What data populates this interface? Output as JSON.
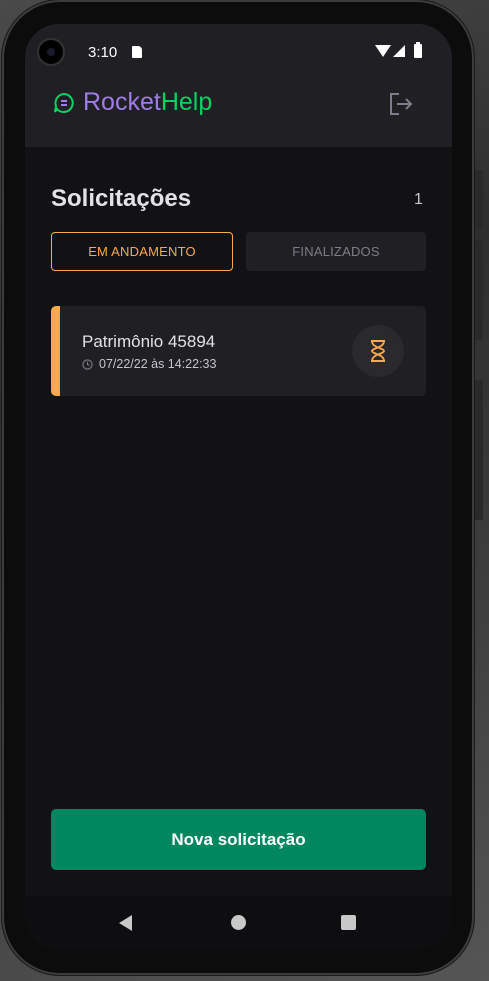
{
  "statusbar": {
    "time": "3:10"
  },
  "header": {
    "logo_part1": "Rocket",
    "logo_part2": "Help",
    "colors": {
      "rocket": "#9f7ce8",
      "help": "#04d361"
    }
  },
  "main": {
    "title": "Solicitações",
    "count": "1",
    "filters": [
      {
        "label": "EM ANDAMENTO",
        "active": true
      },
      {
        "label": "FINALIZADOS",
        "active": false
      }
    ],
    "orders": [
      {
        "title": "Patrimônio 45894",
        "datetime": "07/22/22 às 14:22:33",
        "status": "open",
        "status_icon": "hourglass-icon",
        "status_color": "#fba94c"
      }
    ],
    "new_button_label": "Nova solicitação"
  },
  "theme": {
    "accent": "#00875f",
    "warning": "#fba94c",
    "background": "#121214",
    "surface": "#202024"
  }
}
